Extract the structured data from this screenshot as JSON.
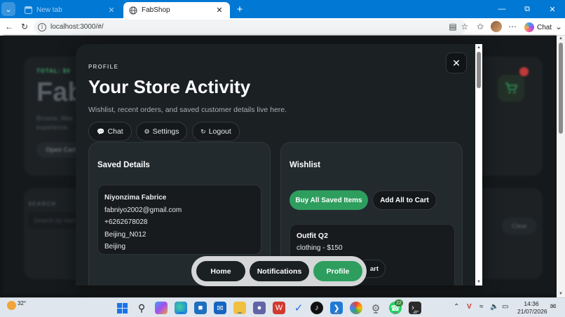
{
  "browser": {
    "tabs": [
      {
        "title": "New tab",
        "active": false
      },
      {
        "title": "FabShop",
        "active": true
      }
    ],
    "url": "localhost:3000/#/",
    "copilot_label": "Chat"
  },
  "background": {
    "total_label": "TOTAL: $0",
    "title": "Fab",
    "subtitle": "Browse, filter, experience.",
    "open_cart": "Open Cart",
    "search_label": "SEARCH",
    "search_placeholder": "Search by nam",
    "clear": "Clear"
  },
  "modal": {
    "kicker": "PROFILE",
    "title": "Your Store Activity",
    "subtitle": "Wishlist, recent orders, and saved customer details live here.",
    "actions": {
      "chat": "Chat",
      "settings": "Settings",
      "logout": "Logout"
    },
    "saved_details": {
      "title": "Saved Details",
      "name": "Niyonzima Fabrice",
      "email": "fabniyo2002@gmail.com",
      "phone": "+6262678028",
      "address": "Beijing_N012",
      "city": "Beijing"
    },
    "wishlist": {
      "title": "Wishlist",
      "buy_all": "Buy All Saved Items",
      "add_all": "Add All to Cart",
      "items": [
        {
          "name": "Outfit Q2",
          "meta": "clothing - $150",
          "add_to_cart": "art"
        }
      ]
    }
  },
  "bottom_nav": {
    "home": "Home",
    "notifications": "Notifications",
    "profile": "Profile"
  },
  "taskbar": {
    "temperature": "32°",
    "badge_count": "22",
    "time": "14:36",
    "date": "21/07/2026"
  },
  "colors": {
    "accent_green": "#2e9e5e",
    "browser_blue": "#0078d4",
    "modal_bg": "#1b2023"
  }
}
